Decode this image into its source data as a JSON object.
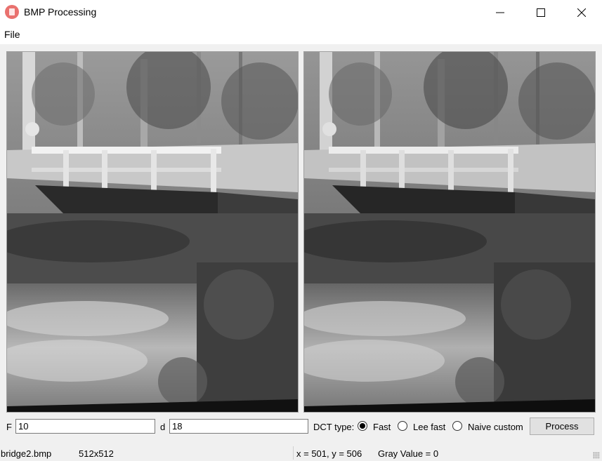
{
  "window": {
    "title": "BMP Processing",
    "icon": "app-bitmap-icon",
    "controls": [
      "minimize-icon",
      "maximize-icon",
      "close-icon"
    ]
  },
  "menu": {
    "file": "File"
  },
  "images": {
    "left": {
      "description_icon": "image-original"
    },
    "right": {
      "description_icon": "image-processed"
    }
  },
  "controls": {
    "f_label": "F",
    "f_value": "10",
    "d_label": "d",
    "d_value": "18",
    "dct_label": "DCT type:",
    "dct_options": [
      {
        "label": "Fast",
        "checked": true
      },
      {
        "label": "Lee fast",
        "checked": false
      },
      {
        "label": "Naive custom",
        "checked": false
      }
    ],
    "process_label": "Process"
  },
  "status": {
    "filename": "bridge2.bmp",
    "dimensions": "512x512",
    "coords": "x = 501, y = 506",
    "gray": "Gray Value = 0"
  }
}
